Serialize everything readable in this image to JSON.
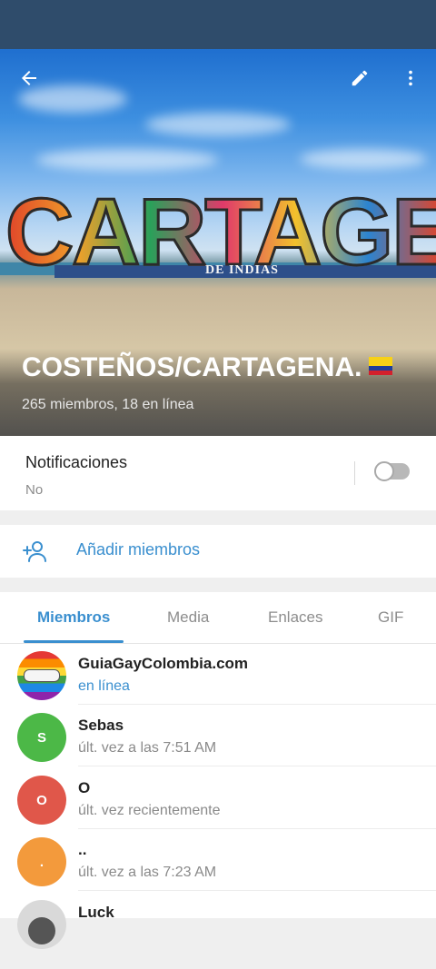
{
  "header": {
    "title": "COSTEÑOS/CARTAGENA.",
    "subtitle": "265 miembros, 18 en línea",
    "photo_text": "CARTAGENA",
    "photo_subtext": "DE INDIAS",
    "back_icon": "arrow-left-icon",
    "edit_icon": "pencil-icon",
    "menu_icon": "more-vertical-icon"
  },
  "notifications": {
    "label": "Notificaciones",
    "value": "No",
    "enabled": false
  },
  "add_members": {
    "label": "Añadir miembros",
    "icon": "add-user-icon"
  },
  "tabs": [
    {
      "label": "Miembros",
      "active": true
    },
    {
      "label": "Media",
      "active": false
    },
    {
      "label": "Enlaces",
      "active": false
    },
    {
      "label": "GIF",
      "active": false
    }
  ],
  "members": [
    {
      "name": "GuiaGayColombia.com",
      "status": "en línea",
      "online": true,
      "avatar_type": "rainbow-logo",
      "initial": ""
    },
    {
      "name": "Sebas",
      "status": "últ. vez a las 7:51 AM",
      "online": false,
      "avatar_type": "initial",
      "initial": "S",
      "color": "#4cb847"
    },
    {
      "name": "O",
      "status": "últ. vez recientemente",
      "online": false,
      "avatar_type": "initial",
      "initial": "O",
      "color": "#e0574a"
    },
    {
      "name": "..",
      "status": "últ. vez a las 7:23 AM",
      "online": false,
      "avatar_type": "initial",
      "initial": ".",
      "color": "#f39a3c"
    },
    {
      "name": "Luck",
      "status": "",
      "online": false,
      "avatar_type": "photo",
      "initial": ""
    }
  ],
  "colors": {
    "accent": "#3a8fcf",
    "status_bar": "#2f4c6b"
  }
}
